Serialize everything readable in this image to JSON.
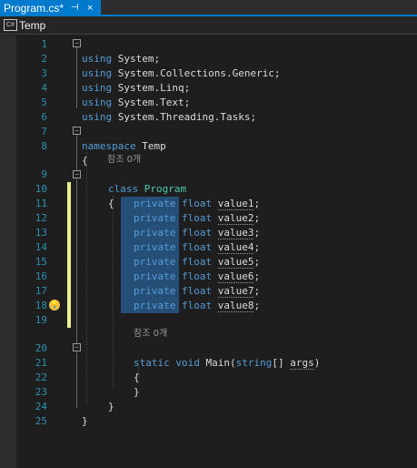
{
  "tab": {
    "title": "Program.cs*",
    "pin": "⊣",
    "close": "×"
  },
  "navbar": {
    "icon": "C#",
    "project": "Temp"
  },
  "code": {
    "l1": [
      "using",
      " System;"
    ],
    "l2": [
      "using",
      " System.Collections.Generic;"
    ],
    "l3": [
      "using",
      " System.Linq;"
    ],
    "l4": [
      "using",
      " System.Text;"
    ],
    "l5": [
      "using",
      " System.Threading.Tasks;"
    ],
    "l7a": "namespace",
    "l7b": " Temp",
    "l8": "{",
    "ref1": "참조 0개",
    "l9a": "class",
    "l9b": "Program",
    "l10": "{",
    "fields": [
      {
        "kw": "private",
        "ty": "float",
        "name": "value1",
        ";": ";"
      },
      {
        "kw": "private",
        "ty": "float",
        "name": "value2"
      },
      {
        "kw": "private",
        "ty": "float",
        "name": "value3"
      },
      {
        "kw": "private",
        "ty": "float",
        "name": "value4"
      },
      {
        "kw": "private",
        "ty": "float",
        "name": "value5"
      },
      {
        "kw": "private",
        "ty": "float",
        "name": "value6"
      },
      {
        "kw": "private",
        "ty": "float",
        "name": "value7"
      },
      {
        "kw": "private",
        "ty": "float",
        "name": "value8"
      }
    ],
    "semi": ";",
    "ref2": "참조 0개",
    "l20a": "static",
    "l20b": "void",
    "l20c": " Main(",
    "l20d": "string",
    "l20e": "[] ",
    "l20f": "args",
    "l20g": ")",
    "l21": "{",
    "l22": "}",
    "l23": "}",
    "l24": "}"
  },
  "line_numbers": [
    "1",
    "2",
    "3",
    "4",
    "5",
    "6",
    "7",
    "8",
    "9",
    "10",
    "11",
    "12",
    "13",
    "14",
    "15",
    "16",
    "17",
    "18",
    "19",
    "20",
    "21",
    "22",
    "23",
    "24",
    "25"
  ],
  "colors": {
    "keyword": "#569cd6",
    "type": "#4ec9b0",
    "line_number": "#2b91af",
    "selection": "#264f78",
    "accent": "#007acc"
  }
}
